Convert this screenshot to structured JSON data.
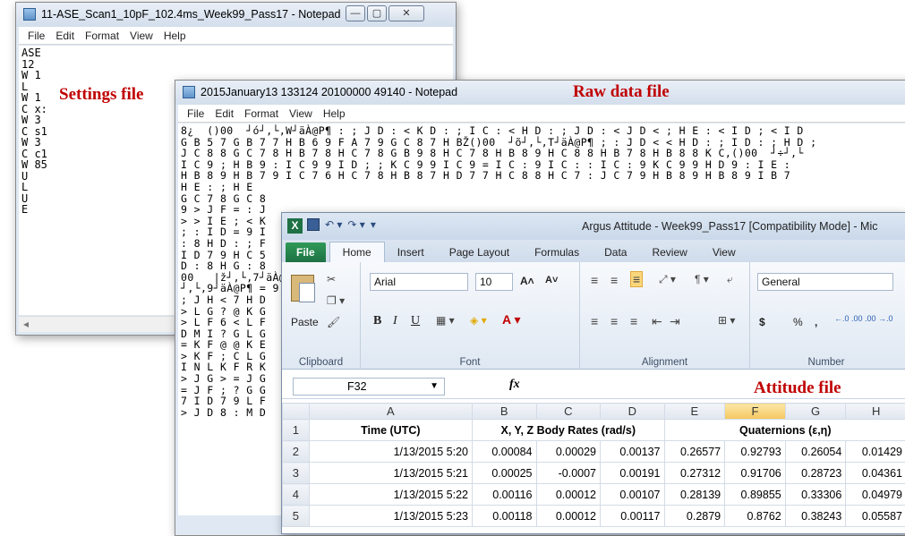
{
  "notepad_settings": {
    "title": "11-ASE_Scan1_10pF_102.4ms_Week99_Pass17 - Notepad",
    "menu": [
      "File",
      "Edit",
      "Format",
      "View",
      "Help"
    ],
    "lines": [
      "ASE",
      "12",
      "W 1",
      "L",
      "W 1",
      "C x:",
      "W 3",
      "C s1",
      "W 3",
      "C c1",
      "W 85",
      "U",
      "L",
      "U",
      "E"
    ],
    "controls": {
      "minimize": "—",
      "maximize": "▢",
      "close": "✕"
    }
  },
  "notepad_raw": {
    "title": "2015January13 133124 20100000 49140 - Notepad",
    "menu": [
      "File",
      "Edit",
      "Format",
      "View",
      "Help"
    ],
    "lines": [
      "8¿  ()00  ┘ó┘,└,W┘äÀ@P¶ : ; J D : < K D : ; I C : < H D : ; J D : < J D < ; H E : < I D ; < I D",
      "G B 5 7 G B 7 7 H B 6 9 F A 7 9 G C 8 7 H BŽ()00  ┘õ┘,└,T┘äÀ@P¶ ; : J D < < H D : ; I D : ; H D ;",
      "J C 8 8 G C 7 8 H B 7 8 H C 7 8 G B 9 8 H C 7 8 H B 8 9 H C 8 8 H B 7 8 H B 8 8 K C,()00  ┘÷┘,└",
      "I C 9 ; H B 9 : I C 9 9 I D ; ; K C 9 9 I C 9 = I C : 9 I C : : I C : 9 K C 9 9 H D 9 : I E :",
      "H B 8 9 H B 7 9 I C 7 6 H C 7 8 H B 8 7 H D 7 7 H C 8 8 H C 7 : J C 7 9 H B 8 9 H B 8 9 I B 7",
      "H E : ; H E",
      "G C 7 8 G C 8",
      "9 > J F = : J",
      "> > I E ; < K",
      "; : I D = 9 I",
      ": 8 H D : ; F",
      "I D 7 9 H C 5",
      "D : 8 H G : 8",
      "00   |ž┘,└,7┘äÀ@P",
      "┘,└,9┘äÀ@P¶ = 9",
      "; J H < 7 H D",
      "> L G ? @ K G",
      "> L F 6 < L F",
      "D M I ? G L G",
      "= K F @ @ K E",
      "> K F ; C L G",
      "I N L K F R K",
      "> J G > = J G",
      "= J F ; ? G G",
      "7 I D 7 9 L F",
      "> J D 8 : M D"
    ]
  },
  "labels": {
    "settings": "Settings file",
    "raw": "Raw data file",
    "attitude": "Attitude file"
  },
  "excel": {
    "title": "Argus Attitude - Week99_Pass17  [Compatibility Mode] - Mic",
    "tabs": [
      "File",
      "Home",
      "Insert",
      "Page Layout",
      "Formulas",
      "Data",
      "Review",
      "View"
    ],
    "ribbon": {
      "paste_label": "Paste",
      "clipboard_label": "Clipboard",
      "font_name": "Arial",
      "font_size": "10",
      "font_label": "Font",
      "alignment_label": "Alignment",
      "number_format": "General",
      "number_label": "Number",
      "bold": "B",
      "italic": "I",
      "underline": "U",
      "grow_font": "A˄",
      "shrink_font": "A˅",
      "currency": "$",
      "percent": "%",
      "comma": ",",
      "inc_decimal": "←.0 .00",
      "dec_decimal": ".00 →.0"
    },
    "name_box": "F32",
    "fx": "fx",
    "columns": [
      "A",
      "B",
      "C",
      "D",
      "E",
      "F",
      "G",
      "H"
    ],
    "selected_column": "F",
    "rows": [
      {
        "num": "1",
        "cells": [
          "Time (UTC)",
          "X, Y, Z Body Rates (rad/s)",
          "",
          "",
          "Quaternions (ε,η)",
          "",
          "",
          ""
        ]
      },
      {
        "num": "2",
        "cells": [
          "1/13/2015 5:20",
          "0.00084",
          "0.00029",
          "0.00137",
          "0.26577",
          "0.92793",
          "0.26054",
          "0.01429"
        ]
      },
      {
        "num": "3",
        "cells": [
          "1/13/2015 5:21",
          "0.00025",
          "-0.0007",
          "0.00191",
          "0.27312",
          "0.91706",
          "0.28723",
          "0.04361"
        ]
      },
      {
        "num": "4",
        "cells": [
          "1/13/2015 5:22",
          "0.00116",
          "0.00012",
          "0.00107",
          "0.28139",
          "0.89855",
          "0.33306",
          "0.04979"
        ]
      },
      {
        "num": "5",
        "cells": [
          "1/13/2015 5:23",
          "0.00118",
          "0.00012",
          "0.00117",
          "0.2879",
          "0.8762",
          "0.38243",
          "0.05587"
        ]
      }
    ]
  },
  "colors": {
    "label_red": "#c00000",
    "excel_green": "#1e7145",
    "selected_header": "#f5c75f"
  }
}
